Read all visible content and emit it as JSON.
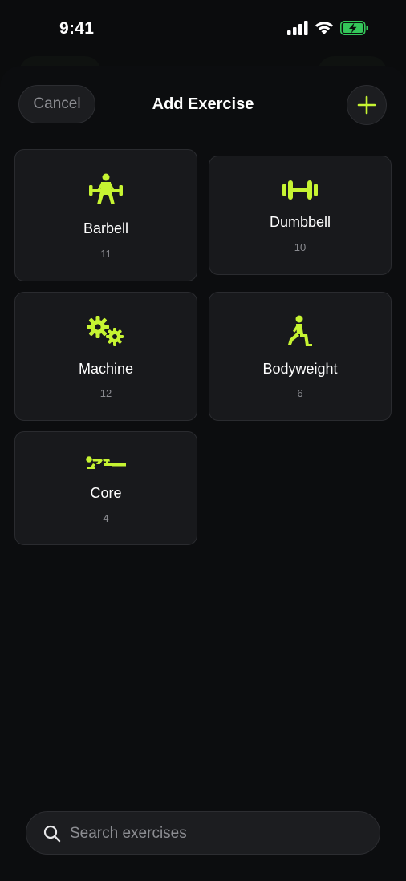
{
  "status_bar": {
    "time": "9:41"
  },
  "header": {
    "cancel_label": "Cancel",
    "title": "Add Exercise",
    "add_icon": "plus-icon"
  },
  "accent_color": "#c6f432",
  "categories": [
    {
      "name": "Barbell",
      "count": "11",
      "icon": "barbell-icon"
    },
    {
      "name": "Dumbbell",
      "count": "10",
      "icon": "dumbbell-icon"
    },
    {
      "name": "Machine",
      "count": "12",
      "icon": "gears-icon"
    },
    {
      "name": "Bodyweight",
      "count": "6",
      "icon": "lunge-figure-icon"
    },
    {
      "name": "Core",
      "count": "4",
      "icon": "core-figure-icon"
    }
  ],
  "search": {
    "placeholder": "Search exercises"
  }
}
